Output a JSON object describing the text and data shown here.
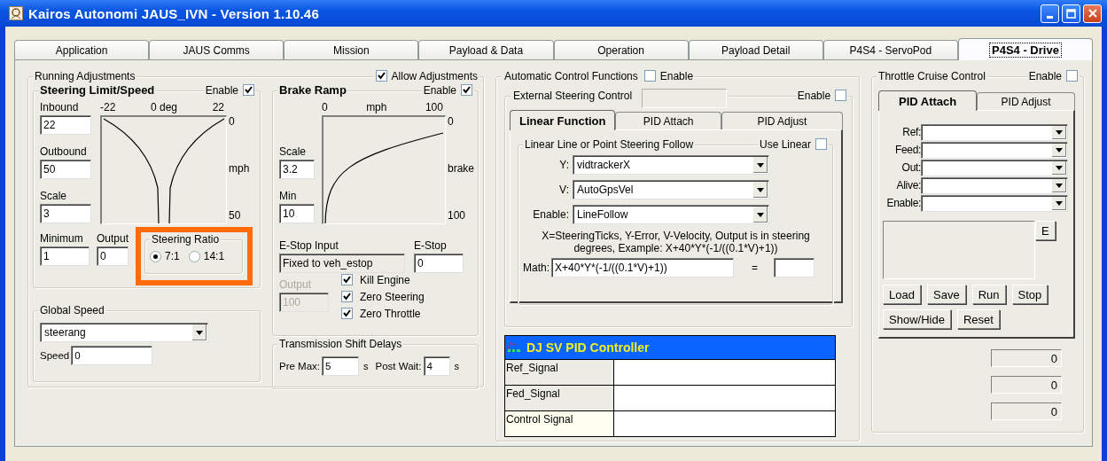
{
  "window": {
    "title": "Kairos Autonomi JAUS_IVN - Version 1.10.46"
  },
  "tabs": [
    {
      "label": "Application",
      "selected": false
    },
    {
      "label": "JAUS Comms",
      "selected": false
    },
    {
      "label": "Mission",
      "selected": false
    },
    {
      "label": "Payload & Data",
      "selected": false
    },
    {
      "label": "Operation",
      "selected": false
    },
    {
      "label": "Payload Detail",
      "selected": false
    },
    {
      "label": "P4S4 - ServoPod",
      "selected": false
    },
    {
      "label": "P4S4 - Drive",
      "selected": true
    }
  ],
  "running_adjustments": {
    "title": "Running Adjustments",
    "allow_adjustments": {
      "label": "Allow Adjustments",
      "checked": true
    },
    "steering": {
      "title": "Steering Limit/Speed",
      "enable": {
        "label": "Enable",
        "checked": true
      },
      "fields": [
        {
          "label": "Inbound",
          "value": "22"
        },
        {
          "label": "Outbound",
          "value": "50"
        },
        {
          "label": "Scale",
          "value": "3"
        }
      ],
      "plot": {
        "x_labels": [
          "-22",
          "0 deg",
          "22"
        ],
        "y_labels": [
          "0",
          "mph",
          "50"
        ]
      },
      "minimum": {
        "label": "Minimum",
        "value": "1"
      },
      "output": {
        "label": "Output",
        "value": "0"
      },
      "ratio": {
        "title": "Steering Ratio",
        "options": [
          {
            "label": "7:1",
            "selected": true
          },
          {
            "label": "14:1",
            "selected": false
          }
        ]
      }
    },
    "brake": {
      "title": "Brake Ramp",
      "enable": {
        "label": "Enable",
        "checked": true
      },
      "plot": {
        "x_labels": [
          "0",
          "mph",
          "100"
        ],
        "y_labels": [
          "0",
          "brake",
          "100"
        ]
      },
      "fields": [
        {
          "label": "Scale",
          "value": "3.2"
        },
        {
          "label": "Min",
          "value": "10"
        }
      ],
      "estop_input": {
        "label": "E-Stop Input",
        "value": "Fixed to veh_estop"
      },
      "estop": {
        "label": "E-Stop",
        "value": "0"
      },
      "output": {
        "label": "Output",
        "value": "100",
        "disabled": true
      },
      "checks": [
        {
          "label": "Kill Engine",
          "checked": true
        },
        {
          "label": "Zero Steering",
          "checked": true
        },
        {
          "label": "Zero Throttle",
          "checked": true
        }
      ]
    },
    "global_speed": {
      "title": "Global Speed",
      "source": "steerang",
      "speed": {
        "label": "Speed",
        "value": "0"
      }
    },
    "transmission": {
      "title": "Transmission Shift Delays",
      "fields": [
        {
          "label": "Pre Max:",
          "value": "5",
          "unit": "s"
        },
        {
          "label": "Post Wait:",
          "value": "4",
          "unit": "s"
        }
      ]
    }
  },
  "automatic": {
    "title": "Automatic Control Functions",
    "enable": {
      "label": "Enable",
      "checked": false
    },
    "external": {
      "title": "External Steering Control",
      "enable": {
        "label": "Enable",
        "checked": false
      },
      "tabs": [
        {
          "label": "Linear Function",
          "selected": true
        },
        {
          "label": "PID Attach",
          "selected": false
        },
        {
          "label": "PID Adjust",
          "selected": false
        }
      ],
      "linear": {
        "title": "Linear Line or Point Steering Follow",
        "use_linear": {
          "label": "Use Linear",
          "checked": false
        },
        "selects": [
          {
            "label": "Y:",
            "value": "vidtrackerX"
          },
          {
            "label": "V:",
            "value": "AutoGpsVel"
          },
          {
            "label": "Enable:",
            "value": "LineFollow"
          }
        ],
        "note": "X=SteeringTicks, Y-Error, V-Velocity, Output is in steering degrees, Example: X+40*Y*(-1/((0.1*V)+1))",
        "math": {
          "label": "Math:",
          "value": "X+40*Y*(-1/((0.1*V)+1))",
          "equals": "="
        }
      }
    },
    "pid": {
      "title": "DJ SV PID Controller",
      "rows": [
        {
          "label": "Ref_Signal"
        },
        {
          "label": "Fed_Signal"
        },
        {
          "label": "Control Signal"
        }
      ]
    }
  },
  "throttle": {
    "title": "Throttle Cruise Control",
    "enable": {
      "label": "Enable",
      "checked": false
    },
    "tabs": [
      {
        "label": "PID Attach",
        "selected": true
      },
      {
        "label": "PID Adjust",
        "selected": false
      }
    ],
    "selects": [
      {
        "label": "Ref:"
      },
      {
        "label": "Feed:"
      },
      {
        "label": "Out:"
      },
      {
        "label": "Alive:"
      },
      {
        "label": "Enable:"
      }
    ],
    "e_button": "E",
    "buttons": [
      [
        "Load",
        "Save",
        "Run",
        "Stop"
      ],
      [
        "Show/Hide",
        "Reset"
      ]
    ],
    "readouts": [
      "0",
      "0",
      "0"
    ]
  }
}
